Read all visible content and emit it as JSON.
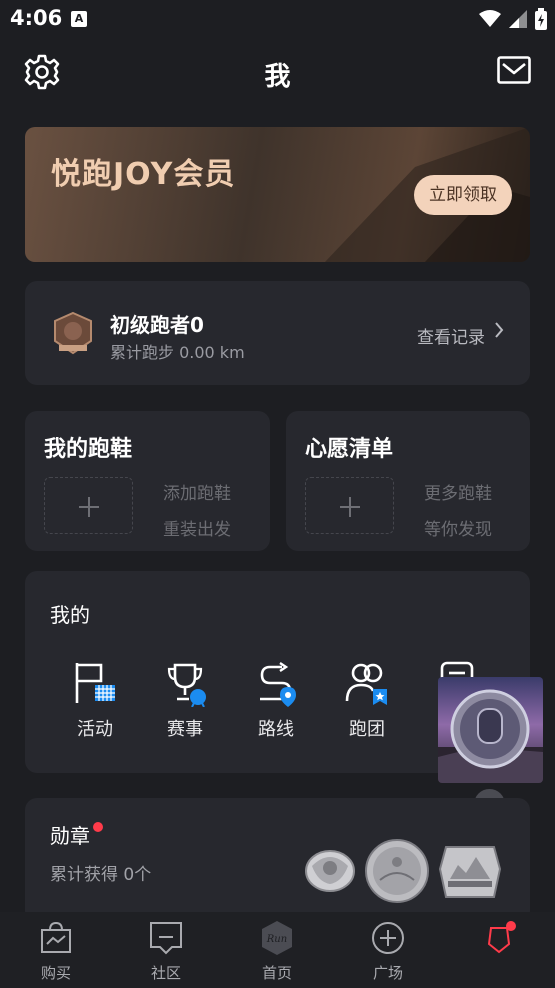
{
  "status": {
    "time": "4:06",
    "notif_letter": "A"
  },
  "header": {
    "title": "我"
  },
  "banner": {
    "title": "悦跑JOY会员",
    "button": "立即领取"
  },
  "runner": {
    "level": "初级跑者0",
    "distance": "累计跑步 0.00 km",
    "history": "查看记录"
  },
  "shoes": {
    "title": "我的跑鞋",
    "line1": "添加跑鞋",
    "line2": "重装出发"
  },
  "wishlist": {
    "title": "心愿清单",
    "line1": "更多跑鞋",
    "line2": "等你发现"
  },
  "mine": {
    "title": "我的",
    "items": [
      {
        "label": "活动",
        "icon": "flag-icon"
      },
      {
        "label": "赛事",
        "icon": "trophy-icon"
      },
      {
        "label": "路线",
        "icon": "route-icon"
      },
      {
        "label": "跑团",
        "icon": "group-icon"
      }
    ]
  },
  "medals": {
    "title": "勋章",
    "subtitle": "累计获得 0个"
  },
  "tabs": [
    {
      "label": "购买",
      "icon": "shopping-bag-icon"
    },
    {
      "label": "社区",
      "icon": "community-icon"
    },
    {
      "label": "首页",
      "icon": "run-logo-icon"
    },
    {
      "label": "广场",
      "icon": "plus-circle-icon"
    },
    {
      "label": "",
      "icon": "profile-icon"
    }
  ],
  "colors": {
    "accent": "#1b8cf0",
    "banner_text": "#f0cdb0",
    "red_dot": "#ff3b4a"
  }
}
